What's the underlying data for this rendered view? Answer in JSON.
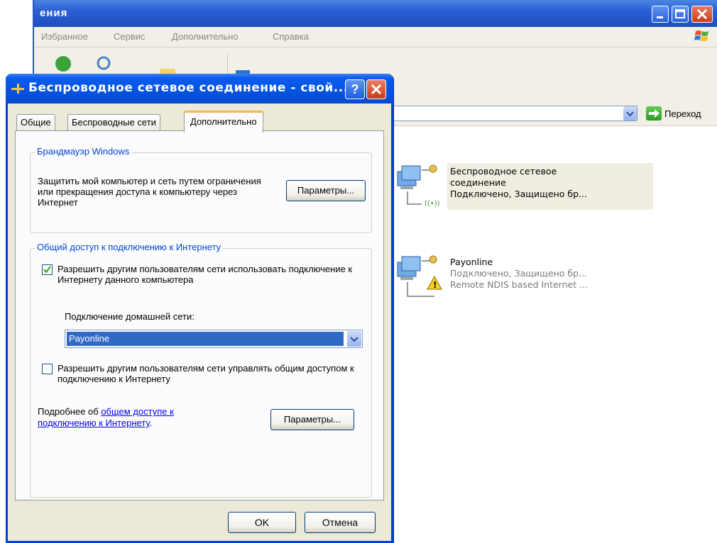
{
  "background_window": {
    "title": "ения",
    "menu": [
      "Избранное",
      "Сервис",
      "Дополнительно",
      "Справка"
    ],
    "go_label": "Переход"
  },
  "connections": [
    {
      "line1": "Беспроводное сетевое",
      "line2": "соединение",
      "status": "Подключено, Защищено бр..."
    },
    {
      "name": "Payonline",
      "status": "Подключено, Защищено бр...",
      "device": "Remote NDIS based Internet ..."
    }
  ],
  "dialog": {
    "title": "Беспроводное сетевое соединение - свой...",
    "tabs": [
      "Общие",
      "Беспроводные сети",
      "Дополнительно"
    ],
    "active_tab": "Дополнительно",
    "firewall": {
      "legend": "Брандмауэр Windows",
      "text": "Защитить мой компьютер и сеть путем ограничения или прекращения доступа к компьютеру через Интернет",
      "button": "Параметры..."
    },
    "ics": {
      "legend": "Общий доступ к подключению к Интернету",
      "allow_share_label": "Разрешить другим пользователям сети использовать подключение к Интернету данного компьютера",
      "allow_share_checked": true,
      "home_network_label": "Подключение домашней сети:",
      "home_network_value": "Payonline",
      "allow_control_label": "Разрешить другим пользователям сети управлять общим доступом к подключению к Интернету",
      "allow_control_checked": false,
      "more_prefix": "Подробнее об ",
      "more_link": "общем доступе к подключению к Интернету",
      "more_suffix": ".",
      "button": "Параметры..."
    },
    "ok": "OK",
    "cancel": "Отмена"
  }
}
